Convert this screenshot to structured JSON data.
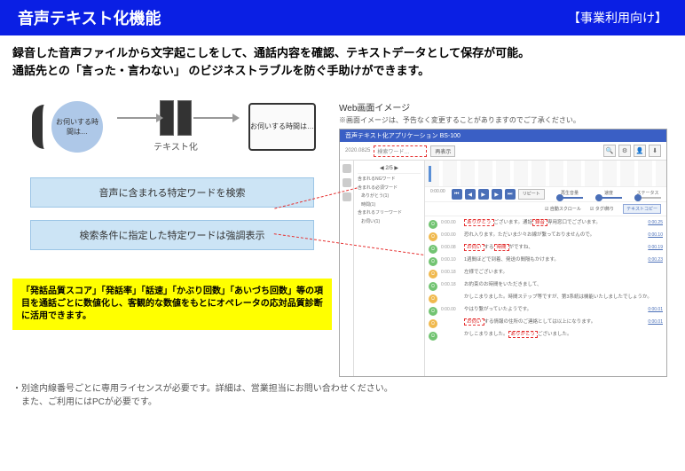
{
  "header": {
    "title": "音声テキスト化機能",
    "audience": "【事業利用向け】"
  },
  "intro": {
    "line1": "録音した音声ファイルから文字起こしをして、通話内容を確認、テキストデータとして保存が可能。",
    "line2": "通話先との「言った・言わない」 のビジネストラブルを防ぐ手助けができます。"
  },
  "diagram": {
    "bubble": "お伺いする時間は…",
    "convert_label": "テキスト化",
    "laptop_text": "お伺いする時間は…"
  },
  "callouts": {
    "search": "音声に含まれる特定ワードを検索",
    "highlight": "検索条件に指定した特定ワードは強調表示"
  },
  "yellow": "「発話品質スコア」「発話率」「話速」「かぶり回数」「あいづち回数」等の項目を通話ごとに数値化し、客観的な数値をもとにオペレータの応対品質診断に活用できます。",
  "footnote": {
    "line1": "・別途内線番号ごとに専用ライセンスが必要です。詳細は、営業担当にお問い合わせください。",
    "line2": "　また、ご利用にはPCが必要です。"
  },
  "web": {
    "caption": "Web画面イメージ",
    "note": "※画面イメージは、予告なく変更することがありますのでご了承ください。"
  },
  "app": {
    "title": "音声テキスト化アプリケーション BS-100",
    "date": "2020.0825",
    "search_placeholder": "検索ワード…",
    "pager": "◀ 2/5 ▶",
    "toolbar_btn": "再表示",
    "left_panel": {
      "r1": "含まれるNGワード",
      "r2": "含まれる必須ワード",
      "r2b": "ありがとう(1)",
      "r2c": "時間(1)",
      "r3": "含まれるフリーワード",
      "r3b": "お伺い(1)"
    },
    "player": {
      "time": "0:00.00",
      "repeat": "リピート",
      "vol_label": "再生音量",
      "spd_label": "速度",
      "stat_label": "ステータス"
    },
    "checks": {
      "autoscroll": "自動スクロール",
      "wrap": "タグ/飾り",
      "copy": "テキストコピー"
    },
    "transcript": [
      {
        "sp": "a",
        "ts": "0:00.00",
        "text": "ありがとうございます。通話録音専用窓口でございます。",
        "rt": "0:00.25"
      },
      {
        "sp": "b",
        "ts": "0:00.00",
        "text": "恐れ入ります。ただいま少々お線が繋っておりませんので。",
        "rt": "0:00.10"
      },
      {
        "sp": "a",
        "ts": "0:00.08",
        "text": "お伺いする時間がですね、",
        "rt": "0:00.19"
      },
      {
        "sp": "a",
        "ts": "0:00.10",
        "text": "1週間ほどで到着、発送の間隔もかけます。",
        "rt": "0:00.23"
      },
      {
        "sp": "b",
        "ts": "0:00.18",
        "text": "左様でございます。",
        "rt": ""
      },
      {
        "sp": "a",
        "ts": "0:00.18",
        "text": "お約束のお時間をいただきまして、",
        "rt": ""
      },
      {
        "sp": "b",
        "ts": "",
        "text": "かしこまりました。時間ステップ等ですが、第3系統は機能いたしましたでしょうか。",
        "rt": ""
      },
      {
        "sp": "a",
        "ts": "0:00.00",
        "text": "やはり繋がっていたようです。",
        "rt": "0:00.01"
      },
      {
        "sp": "b",
        "ts": "",
        "text": "お伺いする情報の住所のご連絡としては以上になります。",
        "rt": "0:00.01"
      },
      {
        "sp": "a",
        "ts": "",
        "text": "かしこまりました。ありがとうございました。",
        "rt": ""
      }
    ]
  }
}
